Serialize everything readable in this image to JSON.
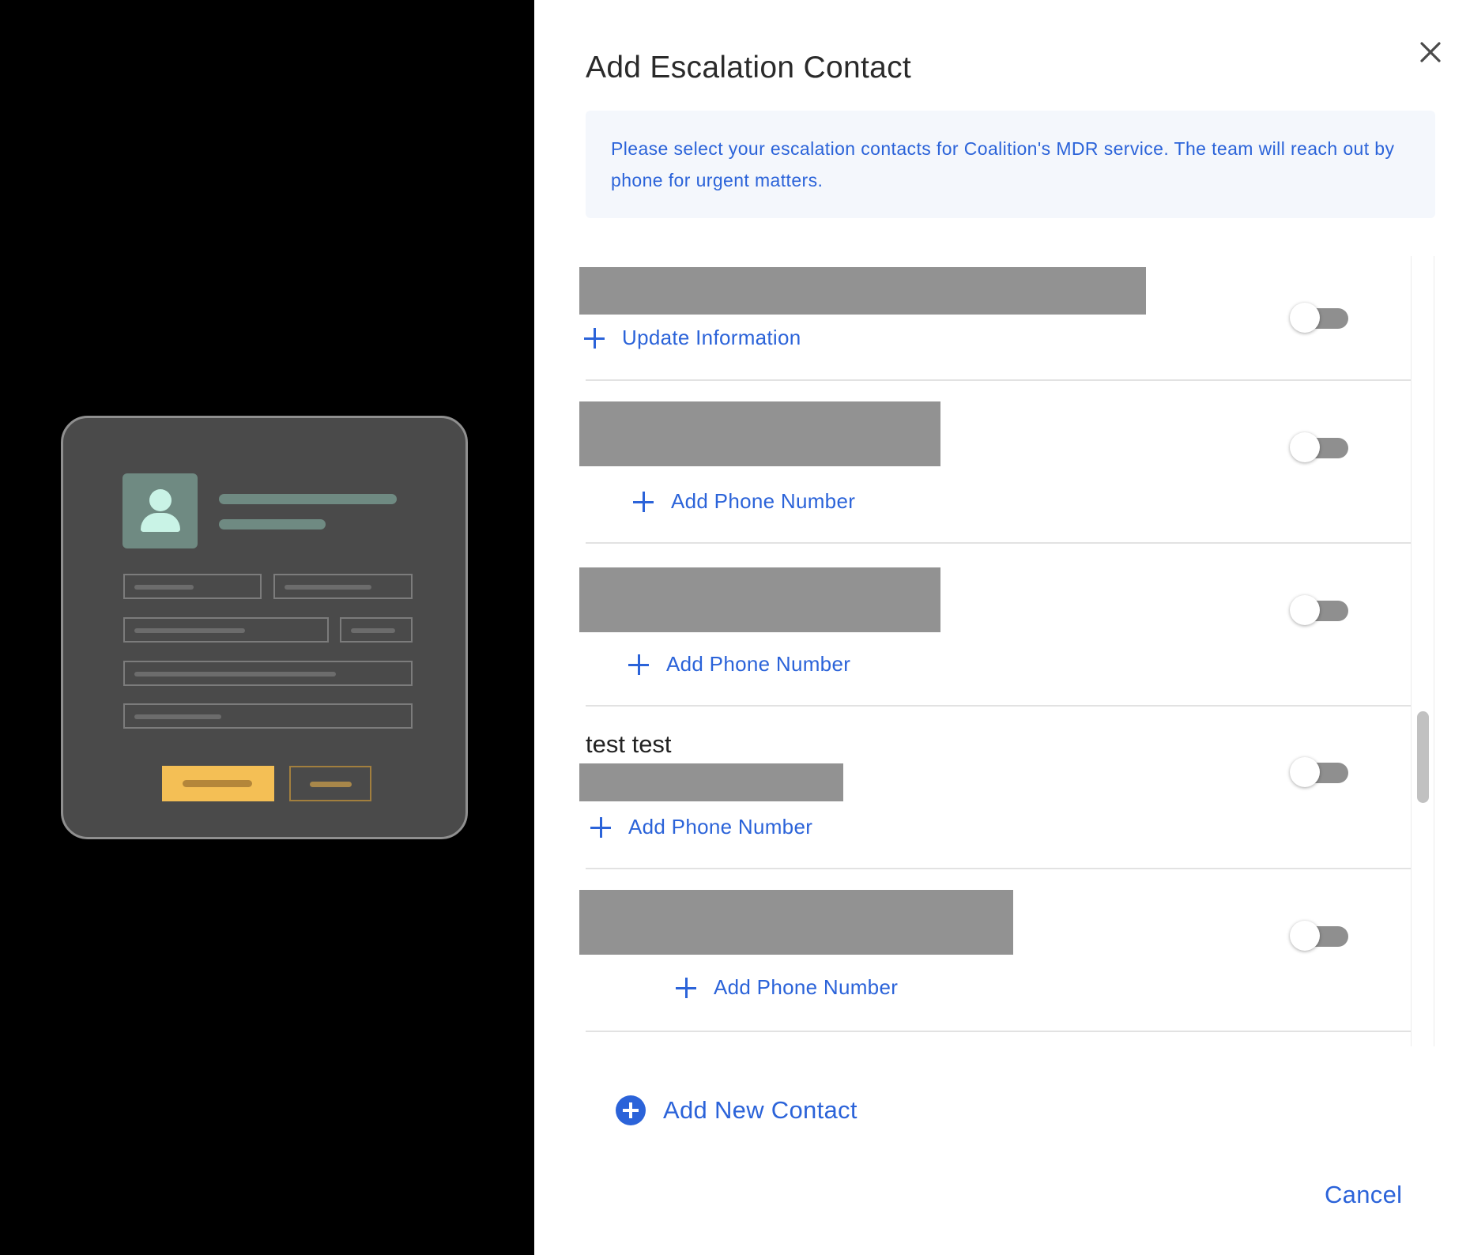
{
  "illustration": {
    "avatar_icon": "person-avatar-icon"
  },
  "drawer": {
    "title": "Add Escalation Contact",
    "close_icon": "close-icon",
    "info_text": "Please select your escalation contacts for Coalition's MDR service. The team will reach out by phone for urgent matters.",
    "contacts": [
      {
        "name": "",
        "redacted": true,
        "action_label": "Update Information",
        "toggle_on": false
      },
      {
        "name": "",
        "redacted": true,
        "action_label": "Add Phone Number",
        "toggle_on": false
      },
      {
        "name": "",
        "redacted": true,
        "action_label": "Add Phone Number",
        "toggle_on": false
      },
      {
        "name": "test test",
        "redacted": true,
        "action_label": "Add Phone Number",
        "toggle_on": false
      },
      {
        "name": "",
        "redacted": true,
        "action_label": "Add Phone Number",
        "toggle_on": false
      }
    ],
    "add_contact_label": "Add New Contact",
    "cancel_label": "Cancel"
  },
  "colors": {
    "accent": "#2b63d9",
    "info_background": "#f4f7fc",
    "redaction": "#929292",
    "toggle_track_off": "#8f8f8f",
    "illustration_card": "#4a4a4a",
    "illustration_button": "#f4bf55"
  }
}
